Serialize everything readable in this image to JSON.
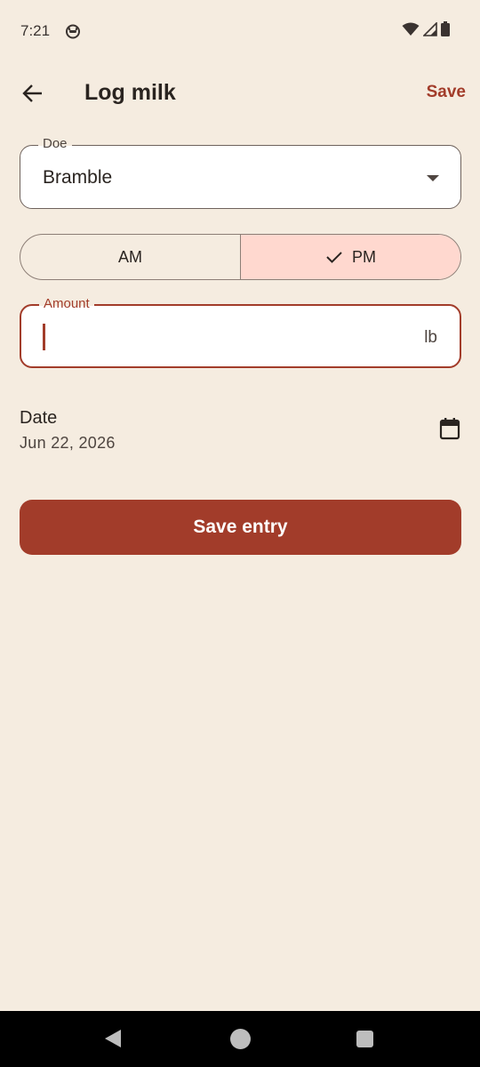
{
  "status_bar": {
    "time": "7:21",
    "app_icon": "cat-face-icon",
    "icons": [
      "wifi-icon",
      "signal-icon",
      "battery-icon"
    ]
  },
  "app_bar": {
    "back_icon": "arrow-back-icon",
    "title": "Log milk",
    "action_label": "Save"
  },
  "form": {
    "doe": {
      "label": "Doe",
      "value": "Bramble",
      "icon": "dropdown-arrow-icon"
    },
    "milking_time": {
      "options": [
        "AM",
        "PM"
      ],
      "selected": "PM",
      "am_label": "AM",
      "pm_label": "PM"
    },
    "amount": {
      "label": "Amount",
      "value": "",
      "unit": "lb"
    },
    "date": {
      "label": "Date",
      "value": "Jun 22, 2026",
      "icon": "calendar-icon"
    },
    "submit_label": "Save entry"
  },
  "nav_bar": {
    "icons": [
      "nav-back-icon",
      "nav-home-icon",
      "nav-recents-icon"
    ]
  },
  "colors": {
    "background": "#F5ECE0",
    "accent": "#A23C2A",
    "selected_segment": "#FFD8CF",
    "surface": "#FFFFFF"
  }
}
